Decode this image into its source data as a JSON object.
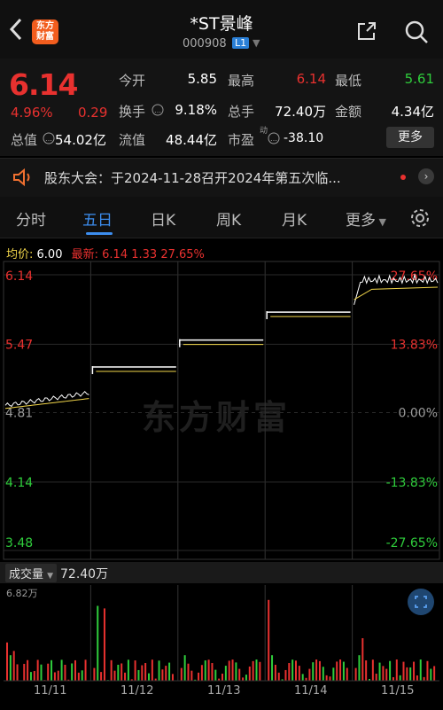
{
  "header": {
    "back_icon": "chevron-left-icon",
    "logo_text_1": "东方",
    "logo_text_2": "财富",
    "title": "*ST景峰",
    "code": "000908",
    "level_badge": "L1"
  },
  "quote": {
    "price": "6.14",
    "pct": "4.96%",
    "change": "0.29",
    "open_label": "今开",
    "open": "5.85",
    "high_label": "最高",
    "high": "6.14",
    "low_label": "最低",
    "low": "5.61",
    "turnover_label": "换手",
    "turnover": "9.18%",
    "volume_label": "总手",
    "volume": "72.40万",
    "amount_label": "金额",
    "amount": "4.34亿",
    "mktcap_label": "总值",
    "mktcap": "54.02亿",
    "float_label": "流值",
    "float": "48.44亿",
    "pe_label": "市盈",
    "pe_sup": "动",
    "pe": "-38.10",
    "more": "更多"
  },
  "notice": {
    "text": "股东大会：于2024-11-28召开2024年第五次临..."
  },
  "tabs": [
    "分时",
    "五日",
    "日K",
    "周K",
    "月K",
    "更多"
  ],
  "active_tab": "五日",
  "legend": {
    "avg_label": "均价:",
    "avg": "6.00",
    "latest_label": "最新:",
    "latest": "6.14",
    "latest_chg": "1.33",
    "latest_pct": "27.65%"
  },
  "watermark": "东方财富",
  "chart_data": {
    "type": "line",
    "title": "",
    "ylim": [
      3.48,
      6.14
    ],
    "y_ticks_left": [
      "6.14",
      "5.47",
      "4.81",
      "4.14",
      "3.48"
    ],
    "y_ticks_right": [
      "27.65%",
      "13.83%",
      "0.00%",
      "-13.83%",
      "-27.65%"
    ],
    "x_labels": [
      "11/11",
      "11/12",
      "11/13",
      "11/14",
      "11/15"
    ],
    "series": [
      {
        "name": "最新",
        "values": [
          {
            "day": "11/11",
            "start": 4.88,
            "end": 5.0
          },
          {
            "day": "11/12",
            "start": 5.25,
            "end": 5.25
          },
          {
            "day": "11/13",
            "start": 5.51,
            "end": 5.51
          },
          {
            "day": "11/14",
            "start": 5.78,
            "end": 5.78
          },
          {
            "day": "11/15",
            "start": 5.85,
            "end": 6.14
          }
        ]
      }
    ],
    "volume": {
      "label": "成交量",
      "total": "72.40万",
      "max_label": "6.82万"
    }
  },
  "colors": {
    "red": "#e8312f",
    "green": "#2fcd3c",
    "accent": "#3c8ef0",
    "avg_line": "#f2d64a"
  }
}
